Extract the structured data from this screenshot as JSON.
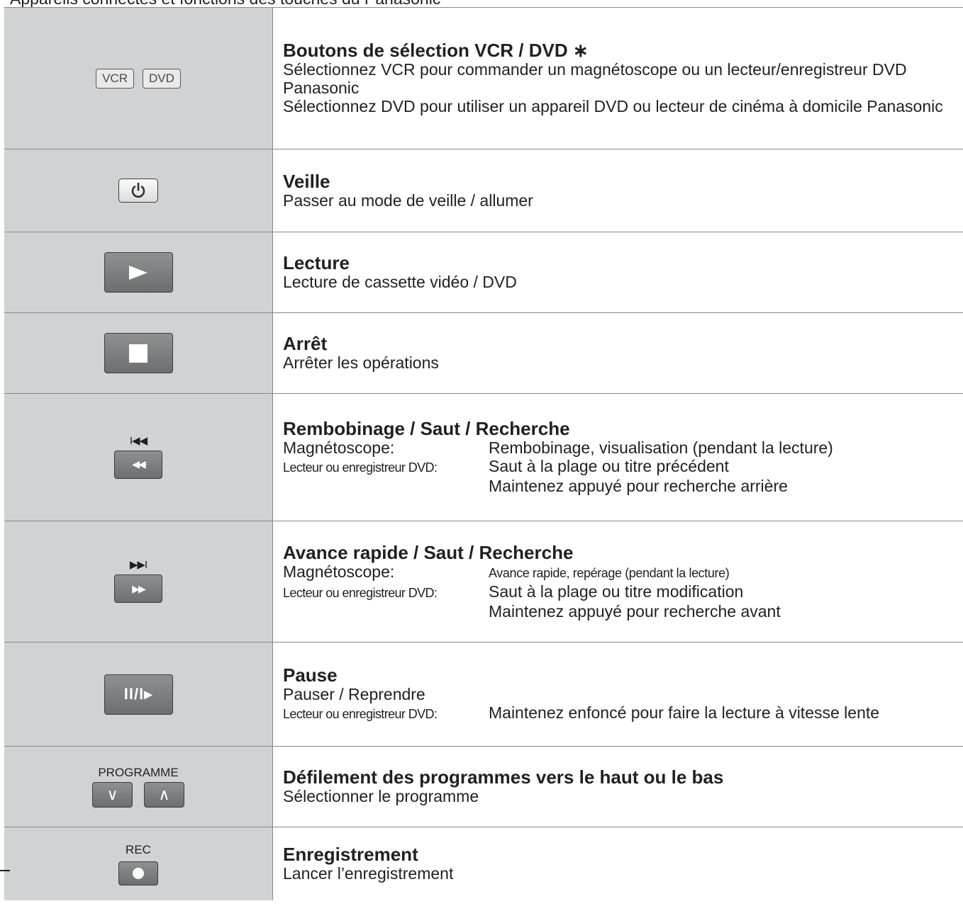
{
  "top_line": "Appareils connectés et fonctions des touches du Panasonic",
  "rows": [
    {
      "title": "Boutons de sélection VCR / DVD ∗",
      "lines": [
        "Sélectionnez VCR pour commander un magnétoscope ou un lecteur/enregistreur DVD Panasonic",
        "Sélectionnez DVD pour utiliser un appareil DVD ou lecteur de cinéma à domicile Panasonic"
      ],
      "buttons": [
        "VCR",
        "DVD"
      ]
    },
    {
      "title": "Veille",
      "lines": [
        "Passer au mode de veille / allumer"
      ],
      "icon": "power-icon"
    },
    {
      "title": "Lecture",
      "lines": [
        "Lecture de cassette vidéo / DVD"
      ],
      "icon": "play-icon"
    },
    {
      "title": "Arrêt",
      "lines": [
        "Arrêter les opérations"
      ],
      "icon": "stop-icon"
    },
    {
      "title": "Rembobinage / Saut / Recherche",
      "glyph_top": "I◀◀",
      "glyph_btn": "◀◀",
      "vcr_label": "Magnétoscope:",
      "vcr_text": "Rembobinage, visualisation (pendant la lecture)",
      "dvd_label": "Lecteur ou enregistreur DVD:",
      "dvd_text": "Saut à la plage ou titre précédent",
      "dvd_text2": "Maintenez appuyé pour recherche arrière"
    },
    {
      "title": "Avance rapide / Saut / Recherche",
      "glyph_top": "▶▶I",
      "glyph_btn": "▶▶",
      "vcr_label": "Magnétoscope:",
      "vcr_text": "Avance rapide, repérage (pendant la lecture)",
      "dvd_label": "Lecteur ou enregistreur DVD:",
      "dvd_text": "Saut à la plage ou titre modification",
      "dvd_text2": "Maintenez appuyé pour recherche avant"
    },
    {
      "title": "Pause",
      "line": "Pauser / Reprendre",
      "dvd_label": "Lecteur ou enregistreur DVD:",
      "dvd_text": "Maintenez enfoncé pour faire la lecture à vitesse lente",
      "glyph": "II/I▸"
    },
    {
      "title": "Défilement des programmes vers le haut ou le bas",
      "lines": [
        "Sélectionner le programme"
      ],
      "caption": "PROGRAMME",
      "down": "∨",
      "up": "∧"
    },
    {
      "title": "Enregistrement",
      "lines": [
        "Lancer l’enregistrement"
      ],
      "caption": "REC",
      "icon": "record-icon"
    }
  ]
}
